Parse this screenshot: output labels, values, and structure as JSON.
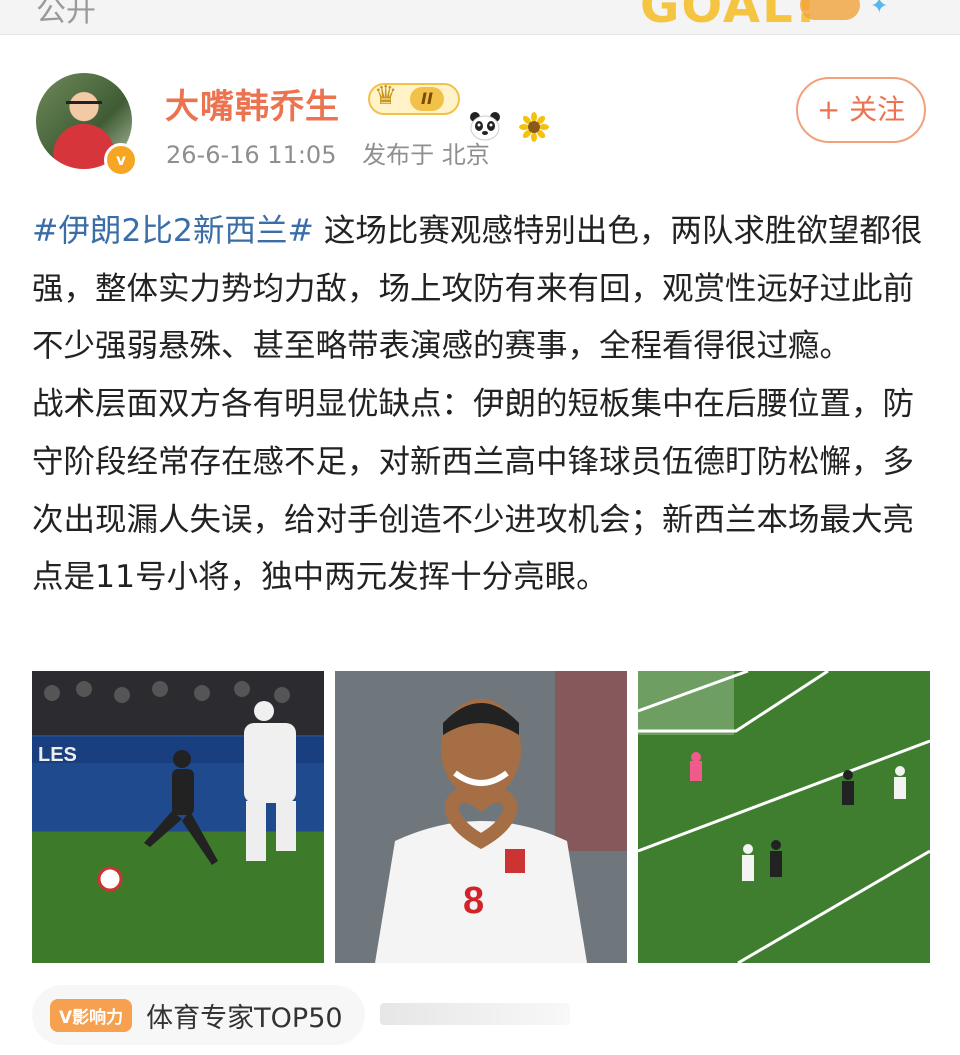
{
  "topbar": {
    "clipped_left": "公开",
    "banner_text": "GOAL!"
  },
  "post": {
    "author": {
      "name": "大嘴韩乔生",
      "vip_level": "II",
      "verified_mark": "v"
    },
    "meta": {
      "timestamp": "26-6-16 11:05",
      "location": "发布于 北京"
    },
    "follow_label": "+ 关注",
    "hashtag": "#伊朗2比2新西兰#",
    "paragraph1": " 这场比赛观感特别出色，两队求胜欲望都很强，整体实力势均力敌，场上攻防有来有回，观赏性远好过此前不少强弱悬殊、甚至略带表演感的赛事，全程看得很过瘾。",
    "paragraph2": "战术层面双方各有明显优缺点：伊朗的短板集中在后腰位置，防守阶段经常存在感不足，对新西兰高中锋球员伍德盯防松懈，多次出现漏人失误，给对手创造不少进攻机会；新西兰本场最大亮点是11号小将，独中两元发挥十分亮眼。",
    "photos": {
      "p1_board": "LES",
      "p2_number": "8"
    },
    "influence": {
      "tag": "V影响力",
      "label": "体育专家TOP50"
    }
  },
  "colors": {
    "brand_orange": "#eb7350",
    "hashtag_blue": "#3b6ea8"
  },
  "icons": [
    "crown-icon",
    "panda-icon",
    "sunflower-icon",
    "verified-badge-icon"
  ]
}
